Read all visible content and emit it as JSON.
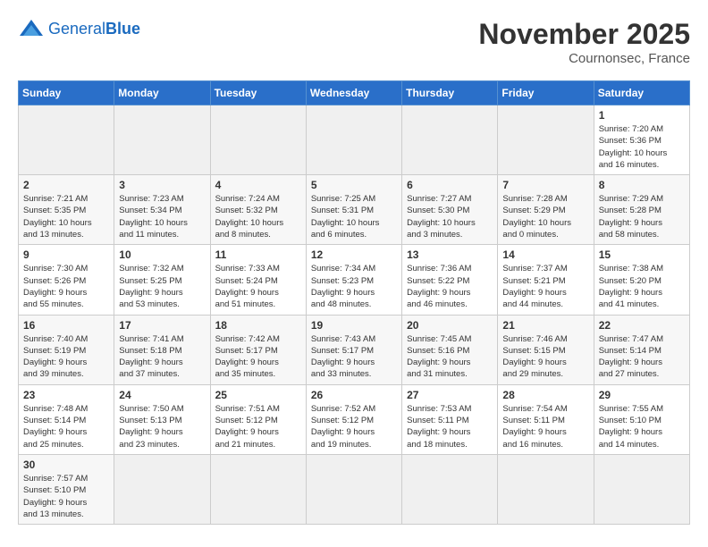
{
  "header": {
    "logo_general": "General",
    "logo_blue": "Blue",
    "month": "November 2025",
    "location": "Cournonsec, France"
  },
  "days_of_week": [
    "Sunday",
    "Monday",
    "Tuesday",
    "Wednesday",
    "Thursday",
    "Friday",
    "Saturday"
  ],
  "weeks": [
    [
      {
        "day": "",
        "info": ""
      },
      {
        "day": "",
        "info": ""
      },
      {
        "day": "",
        "info": ""
      },
      {
        "day": "",
        "info": ""
      },
      {
        "day": "",
        "info": ""
      },
      {
        "day": "",
        "info": ""
      },
      {
        "day": "1",
        "info": "Sunrise: 7:20 AM\nSunset: 5:36 PM\nDaylight: 10 hours\nand 16 minutes."
      }
    ],
    [
      {
        "day": "2",
        "info": "Sunrise: 7:21 AM\nSunset: 5:35 PM\nDaylight: 10 hours\nand 13 minutes."
      },
      {
        "day": "3",
        "info": "Sunrise: 7:23 AM\nSunset: 5:34 PM\nDaylight: 10 hours\nand 11 minutes."
      },
      {
        "day": "4",
        "info": "Sunrise: 7:24 AM\nSunset: 5:32 PM\nDaylight: 10 hours\nand 8 minutes."
      },
      {
        "day": "5",
        "info": "Sunrise: 7:25 AM\nSunset: 5:31 PM\nDaylight: 10 hours\nand 6 minutes."
      },
      {
        "day": "6",
        "info": "Sunrise: 7:27 AM\nSunset: 5:30 PM\nDaylight: 10 hours\nand 3 minutes."
      },
      {
        "day": "7",
        "info": "Sunrise: 7:28 AM\nSunset: 5:29 PM\nDaylight: 10 hours\nand 0 minutes."
      },
      {
        "day": "8",
        "info": "Sunrise: 7:29 AM\nSunset: 5:28 PM\nDaylight: 9 hours\nand 58 minutes."
      }
    ],
    [
      {
        "day": "9",
        "info": "Sunrise: 7:30 AM\nSunset: 5:26 PM\nDaylight: 9 hours\nand 55 minutes."
      },
      {
        "day": "10",
        "info": "Sunrise: 7:32 AM\nSunset: 5:25 PM\nDaylight: 9 hours\nand 53 minutes."
      },
      {
        "day": "11",
        "info": "Sunrise: 7:33 AM\nSunset: 5:24 PM\nDaylight: 9 hours\nand 51 minutes."
      },
      {
        "day": "12",
        "info": "Sunrise: 7:34 AM\nSunset: 5:23 PM\nDaylight: 9 hours\nand 48 minutes."
      },
      {
        "day": "13",
        "info": "Sunrise: 7:36 AM\nSunset: 5:22 PM\nDaylight: 9 hours\nand 46 minutes."
      },
      {
        "day": "14",
        "info": "Sunrise: 7:37 AM\nSunset: 5:21 PM\nDaylight: 9 hours\nand 44 minutes."
      },
      {
        "day": "15",
        "info": "Sunrise: 7:38 AM\nSunset: 5:20 PM\nDaylight: 9 hours\nand 41 minutes."
      }
    ],
    [
      {
        "day": "16",
        "info": "Sunrise: 7:40 AM\nSunset: 5:19 PM\nDaylight: 9 hours\nand 39 minutes."
      },
      {
        "day": "17",
        "info": "Sunrise: 7:41 AM\nSunset: 5:18 PM\nDaylight: 9 hours\nand 37 minutes."
      },
      {
        "day": "18",
        "info": "Sunrise: 7:42 AM\nSunset: 5:17 PM\nDaylight: 9 hours\nand 35 minutes."
      },
      {
        "day": "19",
        "info": "Sunrise: 7:43 AM\nSunset: 5:17 PM\nDaylight: 9 hours\nand 33 minutes."
      },
      {
        "day": "20",
        "info": "Sunrise: 7:45 AM\nSunset: 5:16 PM\nDaylight: 9 hours\nand 31 minutes."
      },
      {
        "day": "21",
        "info": "Sunrise: 7:46 AM\nSunset: 5:15 PM\nDaylight: 9 hours\nand 29 minutes."
      },
      {
        "day": "22",
        "info": "Sunrise: 7:47 AM\nSunset: 5:14 PM\nDaylight: 9 hours\nand 27 minutes."
      }
    ],
    [
      {
        "day": "23",
        "info": "Sunrise: 7:48 AM\nSunset: 5:14 PM\nDaylight: 9 hours\nand 25 minutes."
      },
      {
        "day": "24",
        "info": "Sunrise: 7:50 AM\nSunset: 5:13 PM\nDaylight: 9 hours\nand 23 minutes."
      },
      {
        "day": "25",
        "info": "Sunrise: 7:51 AM\nSunset: 5:12 PM\nDaylight: 9 hours\nand 21 minutes."
      },
      {
        "day": "26",
        "info": "Sunrise: 7:52 AM\nSunset: 5:12 PM\nDaylight: 9 hours\nand 19 minutes."
      },
      {
        "day": "27",
        "info": "Sunrise: 7:53 AM\nSunset: 5:11 PM\nDaylight: 9 hours\nand 18 minutes."
      },
      {
        "day": "28",
        "info": "Sunrise: 7:54 AM\nSunset: 5:11 PM\nDaylight: 9 hours\nand 16 minutes."
      },
      {
        "day": "29",
        "info": "Sunrise: 7:55 AM\nSunset: 5:10 PM\nDaylight: 9 hours\nand 14 minutes."
      }
    ],
    [
      {
        "day": "30",
        "info": "Sunrise: 7:57 AM\nSunset: 5:10 PM\nDaylight: 9 hours\nand 13 minutes."
      },
      {
        "day": "",
        "info": ""
      },
      {
        "day": "",
        "info": ""
      },
      {
        "day": "",
        "info": ""
      },
      {
        "day": "",
        "info": ""
      },
      {
        "day": "",
        "info": ""
      },
      {
        "day": "",
        "info": ""
      }
    ]
  ]
}
